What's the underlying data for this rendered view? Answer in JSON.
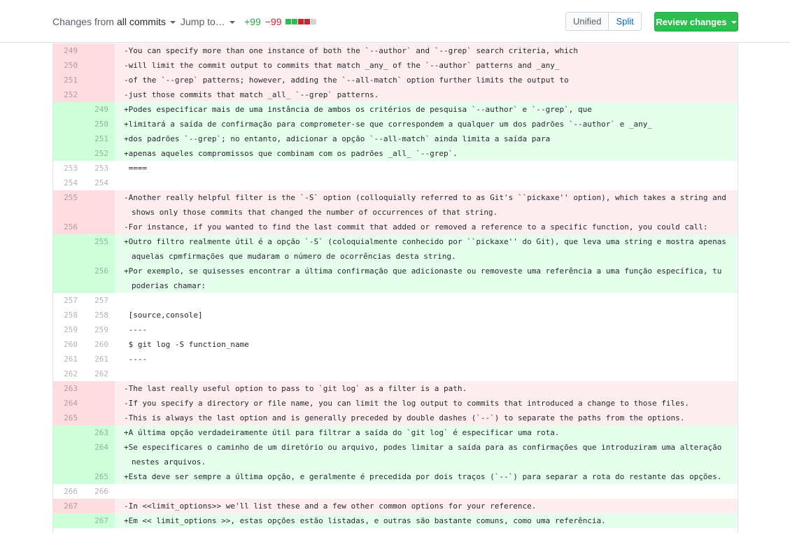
{
  "toolbar": {
    "changes_prefix": "Changes from",
    "changes_value": "all commits",
    "jump_label": "Jump to…",
    "additions": "+99",
    "deletions": "−99",
    "diffstat_colors": [
      "#2cbe4e",
      "#2cbe4e",
      "#cb2431",
      "#cb2431",
      "#d1d5da"
    ],
    "unified_label": "Unified",
    "split_label": "Split",
    "review_label": "Review changes"
  },
  "diff": {
    "lines": [
      {
        "type": "del",
        "old": "249",
        "new": "",
        "text": "-You can specify more than one instance of both the `--author` and `--grep` search criteria, which"
      },
      {
        "type": "del",
        "old": "250",
        "new": "",
        "text": "-will limit the commit output to commits that match _any_ of the `--author` patterns and _any_"
      },
      {
        "type": "del",
        "old": "251",
        "new": "",
        "text": "-of the `--grep` patterns; however, adding the `--all-match` option further limits the output to"
      },
      {
        "type": "del",
        "old": "252",
        "new": "",
        "text": "-just those commits that match _all_ `--grep` patterns."
      },
      {
        "type": "add",
        "old": "",
        "new": "249",
        "text": "+Podes especificar mais de uma instância de ambos os critérios de pesquisa `--author` e `--grep`, que"
      },
      {
        "type": "add",
        "old": "",
        "new": "250",
        "text": "+limitará a saída de confirmação para comprometer-se que correspondem a qualquer um dos padrões `--author` e _any_"
      },
      {
        "type": "add",
        "old": "",
        "new": "251",
        "text": "+dos padrões `--grep`; no entanto, adicionar a opção `--all-match` ainda limita a saída para"
      },
      {
        "type": "add",
        "old": "",
        "new": "252",
        "text": "+apenas aqueles compromissos que combinam com os padrões _all_ `--grep`."
      },
      {
        "type": "ctx",
        "old": "253",
        "new": "253",
        "text": " ===="
      },
      {
        "type": "ctx",
        "old": "254",
        "new": "254",
        "text": " "
      },
      {
        "type": "del",
        "old": "255",
        "new": "",
        "text": "-Another really helpful filter is the `-S` option (colloquially referred to as Git's ``pickaxe'' option), which takes a string and shows only those commits that changed the number of occurrences of that string."
      },
      {
        "type": "del",
        "old": "256",
        "new": "",
        "text": "-For instance, if you wanted to find the last commit that added or removed a reference to a specific function, you could call:"
      },
      {
        "type": "add",
        "old": "",
        "new": "255",
        "text": "+Outro filtro realmente útil é a opção `-S` (coloquialmente conhecido por ``pickaxe'' do Git), que leva uma string e mostra apenas aquelas cpmfirmações que mudaram o número de ocorrências desta string."
      },
      {
        "type": "add",
        "old": "",
        "new": "256",
        "text": "+Por exemplo, se quisesses encontrar a última confirmação que adicionaste ou removeste uma referência a uma função específica, tu poderias chamar:"
      },
      {
        "type": "ctx",
        "old": "257",
        "new": "257",
        "text": " "
      },
      {
        "type": "ctx",
        "old": "258",
        "new": "258",
        "text": " [source,console]"
      },
      {
        "type": "ctx",
        "old": "259",
        "new": "259",
        "text": " ----"
      },
      {
        "type": "ctx",
        "old": "260",
        "new": "260",
        "text": " $ git log -S function_name"
      },
      {
        "type": "ctx",
        "old": "261",
        "new": "261",
        "text": " ----"
      },
      {
        "type": "ctx",
        "old": "262",
        "new": "262",
        "text": " "
      },
      {
        "type": "del",
        "old": "263",
        "new": "",
        "text": "-The last really useful option to pass to `git log` as a filter is a path."
      },
      {
        "type": "del",
        "old": "264",
        "new": "",
        "text": "-If you specify a directory or file name, you can limit the log output to commits that introduced a change to those files."
      },
      {
        "type": "del",
        "old": "265",
        "new": "",
        "text": "-This is always the last option and is generally preceded by double dashes (`--`) to separate the paths from the options."
      },
      {
        "type": "add",
        "old": "",
        "new": "263",
        "text": "+A última opção verdadeiramente útil para filtrar a saída do `git log` é especificar uma rota."
      },
      {
        "type": "add",
        "old": "",
        "new": "264",
        "text": "+Se especificares o caminho de um diretório ou arquivo, podes limitar a saída para as confirmações que introduziram uma alteração nestes arquivos."
      },
      {
        "type": "add",
        "old": "",
        "new": "265",
        "text": "+Esta deve ser sempre a última opção, e geralmente é precedida por dois traços (`--`) para separar a rota do restante das opções."
      },
      {
        "type": "ctx",
        "old": "266",
        "new": "266",
        "text": " "
      },
      {
        "type": "del",
        "old": "267",
        "new": "",
        "text": "-In <<limit_options>> we'll list these and a few other common options for your reference."
      },
      {
        "type": "add",
        "old": "",
        "new": "267",
        "text": "+Em << limit_options >>, estas opções estão listadas, e outras são bastante comuns, como uma referência."
      }
    ]
  }
}
